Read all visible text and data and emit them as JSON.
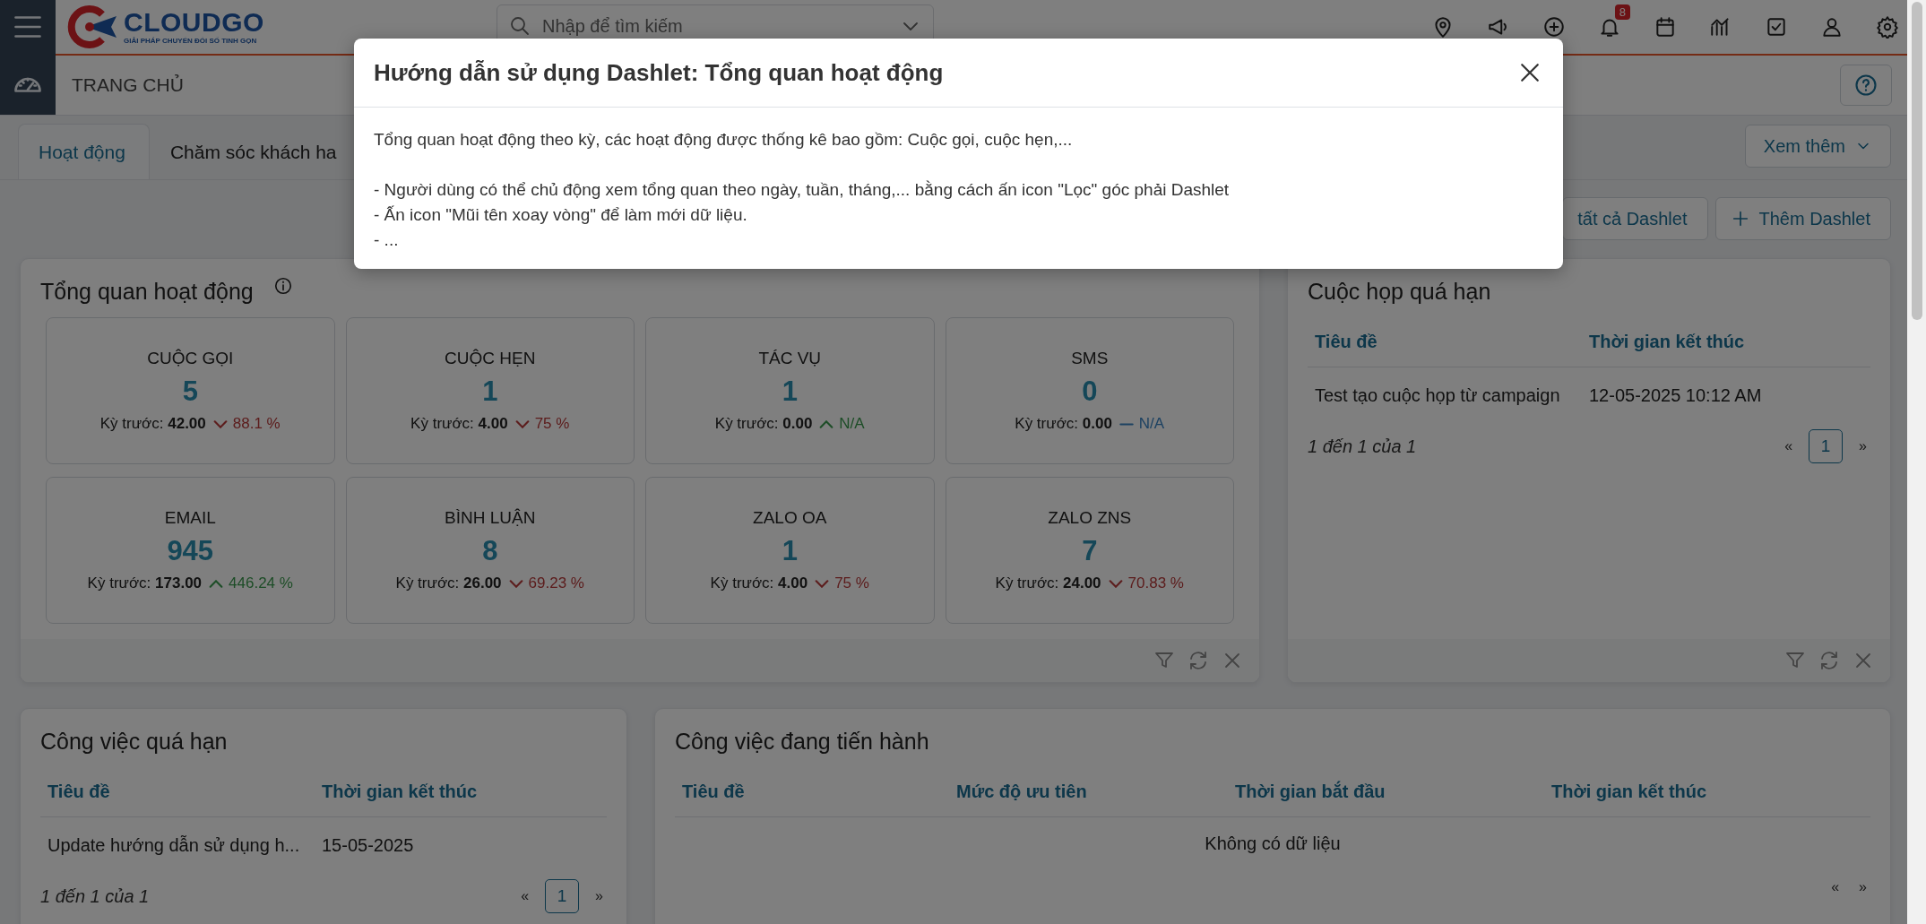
{
  "header": {
    "logo": {
      "name": "CLOUDGO",
      "tagline": "GIẢI PHÁP CHUYỂN ĐỔI SỐ TINH GỌN"
    },
    "search": {
      "placeholder": "Nhập để tìm kiếm"
    },
    "notification_count": "8",
    "breadcrumb": "TRANG CHỦ"
  },
  "tabs": [
    {
      "label": "Hoạt động",
      "selected": true
    },
    {
      "label": "Chăm sóc khách ha",
      "selected": false
    }
  ],
  "more_button": "Xem thêm",
  "actions": [
    {
      "kind": "plain",
      "label": "tất cả Dashlet"
    },
    {
      "kind": "add",
      "label": "Thêm Dashlet"
    }
  ],
  "activity": {
    "title": "Tổng quan hoạt động",
    "metrics": [
      {
        "label": "CUỘC GỌI",
        "value": "5",
        "previous_label": "Kỳ trước:",
        "previous_value": "42.00",
        "kind": "down",
        "change": "88.1 %"
      },
      {
        "label": "CUỘC HẸN",
        "value": "1",
        "previous_label": "Kỳ trước:",
        "previous_value": "4.00",
        "kind": "down",
        "change": "75 %"
      },
      {
        "label": "TÁC VỤ",
        "value": "1",
        "previous_label": "Kỳ trước:",
        "previous_value": "0.00",
        "kind": "up",
        "change": "N/A"
      },
      {
        "label": "SMS",
        "value": "0",
        "previous_label": "Kỳ trước:",
        "previous_value": "0.00",
        "kind": "flat",
        "change": "N/A"
      },
      {
        "label": "EMAIL",
        "value": "945",
        "previous_label": "Kỳ trước:",
        "previous_value": "173.00",
        "kind": "up",
        "change": "446.24 %"
      },
      {
        "label": "BÌNH LUẬN",
        "value": "8",
        "previous_label": "Kỳ trước:",
        "previous_value": "26.00",
        "kind": "down",
        "change": "69.23 %"
      },
      {
        "label": "ZALO OA",
        "value": "1",
        "previous_label": "Kỳ trước:",
        "previous_value": "4.00",
        "kind": "down",
        "change": "75 %"
      },
      {
        "label": "ZALO ZNS",
        "value": "7",
        "previous_label": "Kỳ trước:",
        "previous_value": "24.00",
        "kind": "down",
        "change": "70.83 %"
      }
    ]
  },
  "overdue_meetings": {
    "title": "Cuộc họp quá hạn",
    "columns": [
      "Tiêu đề",
      "Thời gian kết thúc"
    ],
    "rows": [
      [
        "Test tạo cuộc họp từ campaign",
        "12-05-2025 10:12 AM"
      ]
    ],
    "summary": "1 đến 1 của 1",
    "prev": "«",
    "next": "»",
    "pages": [
      {
        "label": "1",
        "selected": true
      }
    ]
  },
  "overdue_tasks": {
    "title": "Công việc quá hạn",
    "columns": [
      "Tiêu đề",
      "Thời gian kết thúc"
    ],
    "rows": [
      [
        "Update hướng dẫn sử dụng h...",
        "15-05-2025"
      ]
    ],
    "summary": "1 đến 1 của 1",
    "prev": "«",
    "next": "»",
    "pages": [
      {
        "label": "1",
        "selected": true
      }
    ]
  },
  "tasks_in_progress": {
    "title": "Công việc đang tiến hành",
    "columns": [
      "Tiêu đề",
      "Mức độ ưu tiên",
      "Thời gian bắt đầu",
      "Thời gian kết thúc"
    ],
    "empty": "Không có dữ liệu",
    "prev": "«",
    "next": "»"
  },
  "modal": {
    "title": "Hướng dẫn sử dụng Dashlet: Tổng quan hoạt động",
    "intro": "Tổng quan hoạt động theo kỳ, các hoạt động được thống kê bao gồm: Cuộc gọi, cuộc hẹn,...",
    "bullets": [
      "- Người dùng có thể chủ động xem tổng quan theo ngày, tuần, tháng,... bằng cách ấn icon \"Lọc\" góc phải Dashlet",
      "- Ấn icon \"Mũi tên xoay vòng\" để làm mới dữ liệu.",
      "- ..."
    ]
  }
}
